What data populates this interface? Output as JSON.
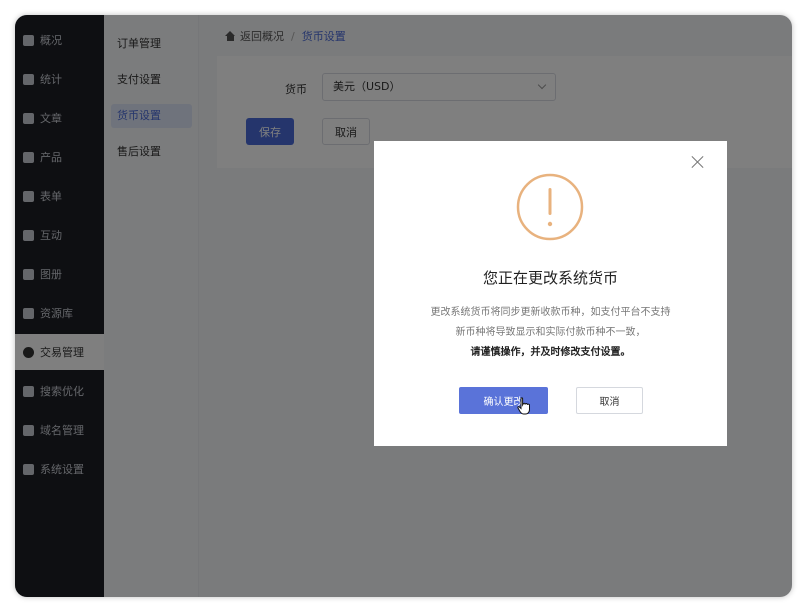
{
  "sidebar": {
    "items": [
      {
        "label": "概况",
        "icon": "home-icon"
      },
      {
        "label": "统计",
        "icon": "chart-icon"
      },
      {
        "label": "文章",
        "icon": "article-icon"
      },
      {
        "label": "产品",
        "icon": "product-icon"
      },
      {
        "label": "表单",
        "icon": "form-icon"
      },
      {
        "label": "互动",
        "icon": "chat-icon"
      },
      {
        "label": "图册",
        "icon": "album-icon"
      },
      {
        "label": "资源库",
        "icon": "database-icon"
      },
      {
        "label": "交易管理",
        "icon": "transaction-icon",
        "active": true
      },
      {
        "label": "搜索优化",
        "icon": "seo-icon"
      },
      {
        "label": "域名管理",
        "icon": "domain-icon"
      },
      {
        "label": "系统设置",
        "icon": "gear-icon"
      }
    ]
  },
  "submenu": {
    "items": [
      {
        "label": "订单管理"
      },
      {
        "label": "支付设置"
      },
      {
        "label": "货币设置",
        "active": true
      },
      {
        "label": "售后设置"
      }
    ]
  },
  "breadcrumb": {
    "back": "返回概况",
    "separator": "/",
    "current": "货币设置"
  },
  "form": {
    "currency_label": "货币",
    "currency_value": "美元（USD）",
    "save_label": "保存",
    "cancel_label": "取消"
  },
  "dialog": {
    "title": "您正在更改系统货币",
    "line1": "更改系统货币将同步更新收款币种，如支付平台不支持",
    "line2": "新币种将导致显示和实际付款币种不一致，",
    "line3": "请谨慎操作，并及时修改支付设置。",
    "confirm_label": "确认更改",
    "cancel_label": "取消"
  },
  "colors": {
    "primary": "#4a6bd8",
    "warning": "#e8b27e",
    "sidebar_bg": "#1d1f24"
  }
}
